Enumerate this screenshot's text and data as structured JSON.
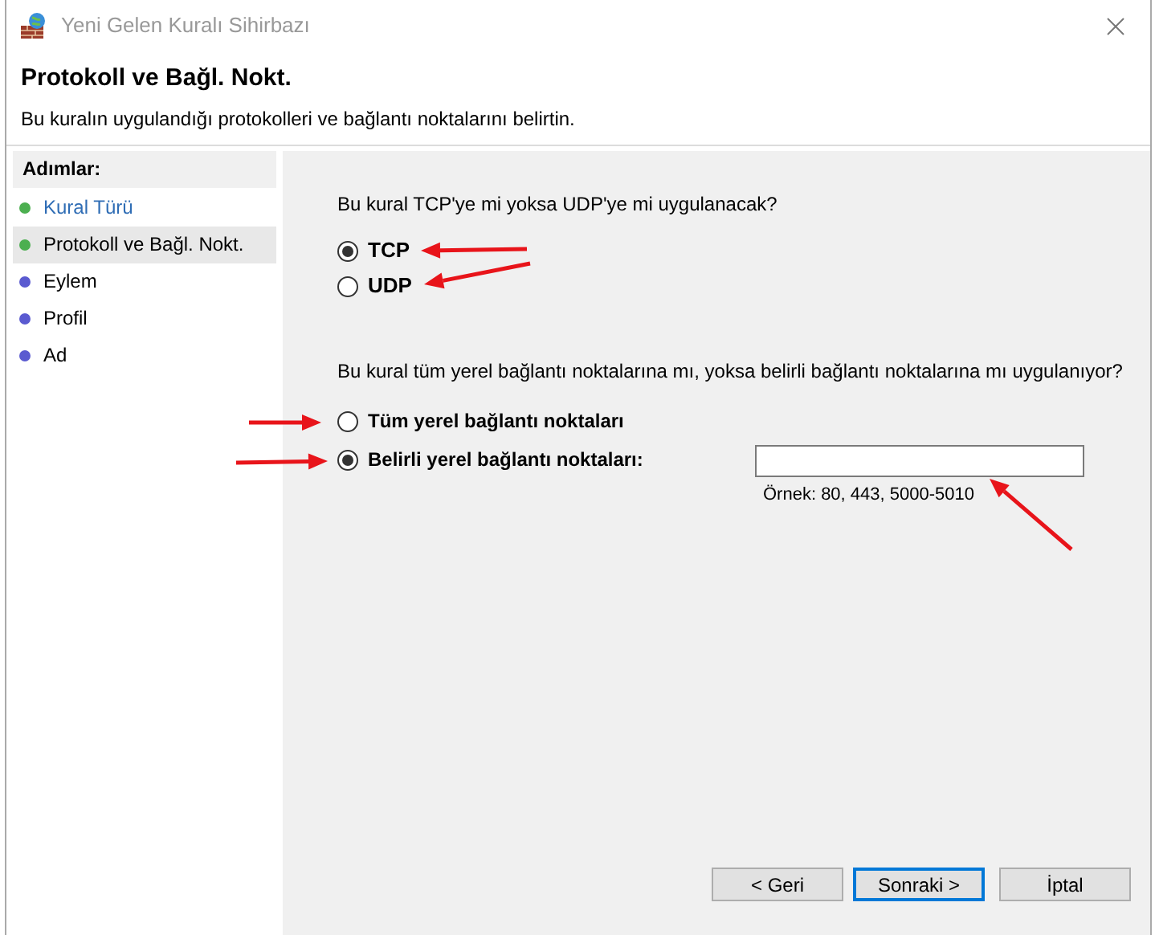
{
  "window": {
    "title": "Yeni Gelen Kuralı Sihirbazı"
  },
  "header": {
    "title": "Protokoll ve Bağl. Nokt.",
    "subtitle": "Bu kuralın uygulandığı protokolleri ve bağlantı noktalarını belirtin."
  },
  "steps": {
    "heading": "Adımlar:",
    "items": [
      {
        "label": "Kural Türü",
        "selected": false,
        "link": true,
        "color": "#4caf50"
      },
      {
        "label": "Protokoll ve Bağl. Nokt.",
        "selected": true,
        "link": false,
        "color": "#4caf50"
      },
      {
        "label": "Eylem",
        "selected": false,
        "link": false,
        "color": "#5a5ad0"
      },
      {
        "label": "Profil",
        "selected": false,
        "link": false,
        "color": "#5a5ad0"
      },
      {
        "label": "Ad",
        "selected": false,
        "link": false,
        "color": "#5a5ad0"
      }
    ]
  },
  "protocol": {
    "question": "Bu kural TCP'ye mi yoksa UDP'ye mi uygulanacak?",
    "options": [
      {
        "label": "TCP",
        "selected": true
      },
      {
        "label": "UDP",
        "selected": false
      }
    ]
  },
  "ports": {
    "question": "Bu kural tüm yerel bağlantı noktalarına mı, yoksa belirli bağlantı noktalarına mı uygulanıyor?",
    "options": [
      {
        "label": "Tüm yerel bağlantı noktaları",
        "selected": false
      },
      {
        "label": "Belirli yerel bağlantı noktaları:",
        "selected": true
      }
    ],
    "hint": "Örnek: 80, 443, 5000-5010"
  },
  "buttons": [
    {
      "label": "< Geri",
      "default": false
    },
    {
      "label": "Sonraki >",
      "default": true
    },
    {
      "label": "İptal",
      "default": false
    }
  ]
}
